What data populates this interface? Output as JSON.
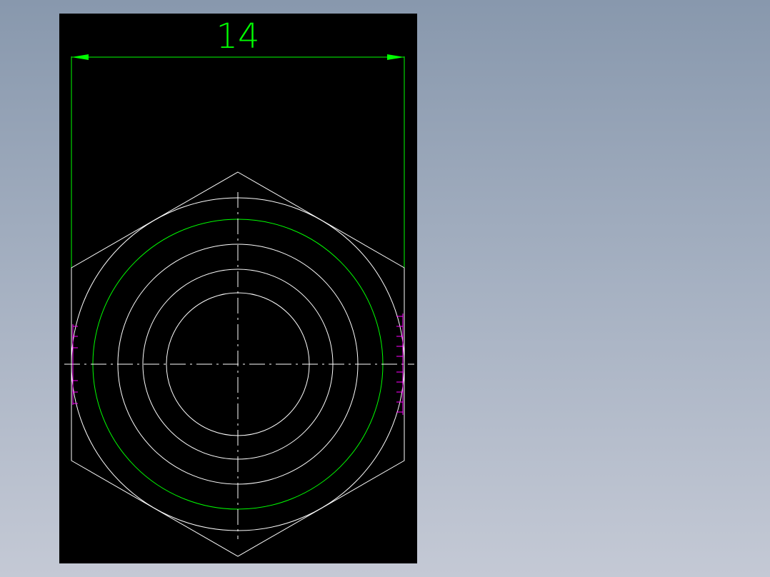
{
  "drawing": {
    "background_color": "#000000",
    "page_color": "#9aa6b8",
    "dimension": {
      "value_text": "14",
      "color": "#00ff00"
    },
    "colors": {
      "geometry": "#ffffff",
      "thread_circle": "#00ff00",
      "hidden_marks": "#ff00ff"
    }
  }
}
